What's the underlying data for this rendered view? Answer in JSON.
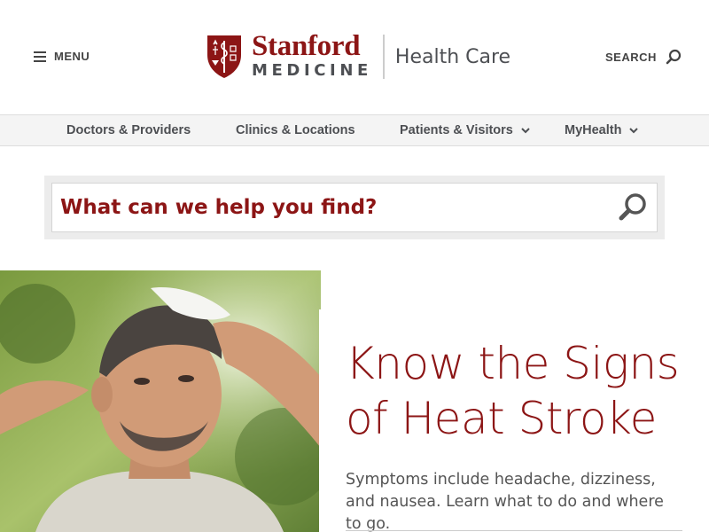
{
  "header": {
    "menu_label": "MENU",
    "logo_stanford": "Stanford",
    "logo_medicine": "MEDICINE",
    "logo_healthcare": "Health Care",
    "search_label": "SEARCH"
  },
  "nav": {
    "items": [
      {
        "label": "Doctors & Providers",
        "has_dropdown": false
      },
      {
        "label": "Clinics & Locations",
        "has_dropdown": false
      },
      {
        "label": "Patients & Visitors",
        "has_dropdown": true
      },
      {
        "label": "MyHealth",
        "has_dropdown": true
      }
    ]
  },
  "find": {
    "placeholder": "What can we help you find?",
    "value": ""
  },
  "hero": {
    "title": "Know the Signs of Heat Stroke",
    "description": "Symptoms include headache, dizziness, and nausea. Learn what to do and where to go.",
    "image": "man-wiping-forehead-in-heat"
  },
  "colors": {
    "brand": "#8c1515",
    "text_gray": "#4d4f53",
    "nav_bg": "#f4f4f4"
  },
  "icons": {
    "menu": "hamburger-icon",
    "search": "search-icon",
    "chevron": "chevron-down-icon",
    "shield": "stanford-shield-logo"
  }
}
